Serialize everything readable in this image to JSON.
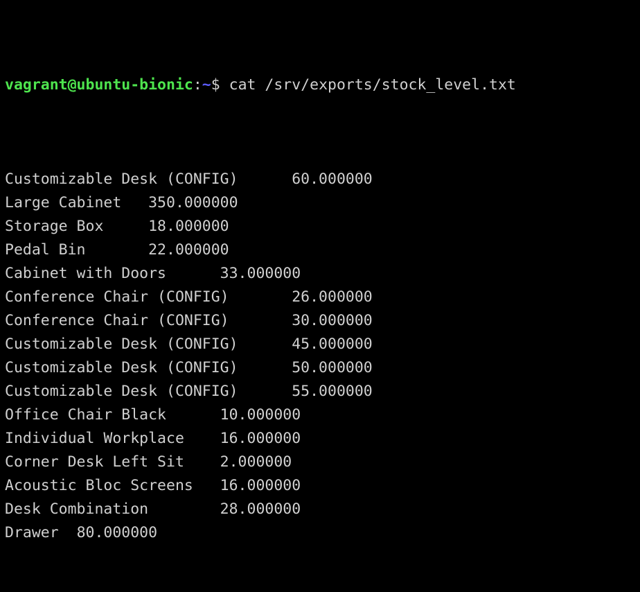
{
  "terminal": {
    "background_color": "#000000",
    "foreground_color": "#d0d0d0",
    "prompt_user_host_color": "#4ee44e",
    "prompt_path_color": "#5c5cff",
    "prompt": {
      "user_host": "vagrant@ubuntu-bionic",
      "separator": ":",
      "path": "~",
      "symbol": "$"
    },
    "command": "cat /srv/exports/stock_level.txt",
    "rows": [
      {
        "name": "Customizable Desk (CONFIG)",
        "value": "60.000000"
      },
      {
        "name": "Large Cabinet",
        "value": "350.000000"
      },
      {
        "name": "Storage Box",
        "value": "18.000000"
      },
      {
        "name": "Pedal Bin",
        "value": "22.000000"
      },
      {
        "name": "Cabinet with Doors",
        "value": "33.000000"
      },
      {
        "name": "Conference Chair (CONFIG)",
        "value": "26.000000"
      },
      {
        "name": "Conference Chair (CONFIG)",
        "value": "30.000000"
      },
      {
        "name": "Customizable Desk (CONFIG)",
        "value": "45.000000"
      },
      {
        "name": "Customizable Desk (CONFIG)",
        "value": "50.000000"
      },
      {
        "name": "Customizable Desk (CONFIG)",
        "value": "55.000000"
      },
      {
        "name": "Office Chair Black",
        "value": "10.000000"
      },
      {
        "name": "Individual Workplace",
        "value": "16.000000"
      },
      {
        "name": "Corner Desk Left Sit",
        "value": "2.000000"
      },
      {
        "name": "Acoustic Bloc Screens",
        "value": "16.000000"
      },
      {
        "name": "Desk Combination",
        "value": "28.000000"
      },
      {
        "name": "Drawer",
        "value": "80.000000"
      }
    ]
  }
}
